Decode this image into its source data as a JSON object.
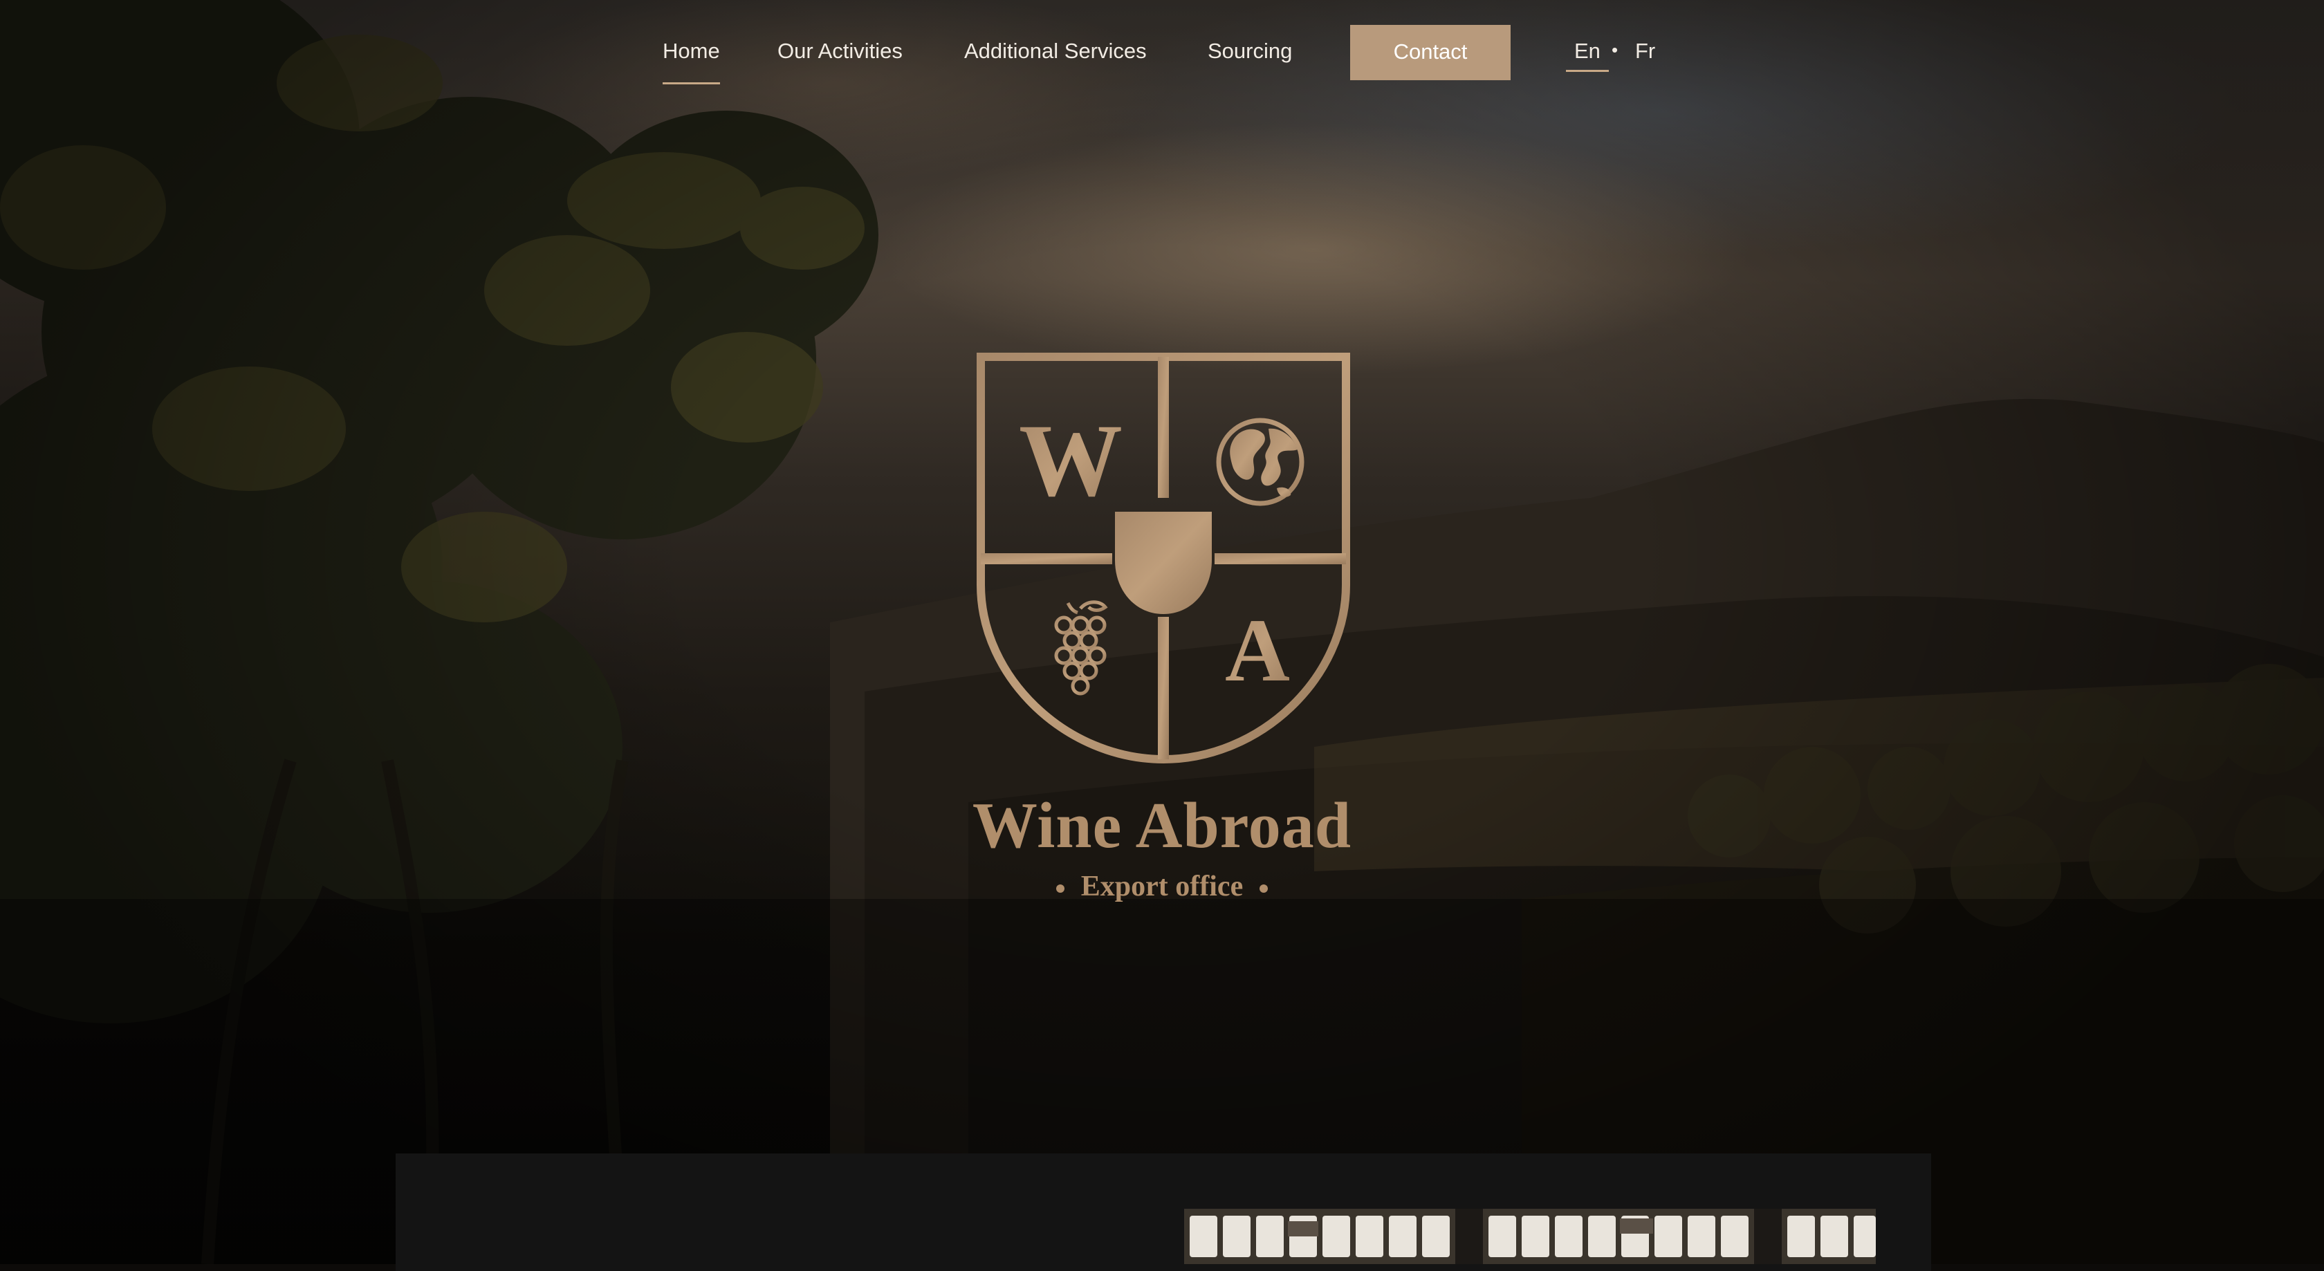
{
  "nav": {
    "items": [
      {
        "label": "Home",
        "active": true
      },
      {
        "label": "Our Activities",
        "active": false
      },
      {
        "label": "Additional Services",
        "active": false
      },
      {
        "label": "Sourcing",
        "active": false
      }
    ],
    "contact_label": "Contact",
    "languages": [
      {
        "label": "En",
        "active": true
      },
      {
        "label": "Fr",
        "active": false
      }
    ],
    "language_separator": "•"
  },
  "logo": {
    "letter_top": "W",
    "letter_bottom": "A",
    "icons": [
      "globe-icon",
      "wine-glass-icon",
      "grapes-icon"
    ],
    "title": "Wine Abroad",
    "subtitle": "Export office"
  },
  "colors": {
    "accent": "#b89a7c",
    "gold": "#b08e6b",
    "nav_text": "#f2ece4",
    "panel": "#141414"
  }
}
